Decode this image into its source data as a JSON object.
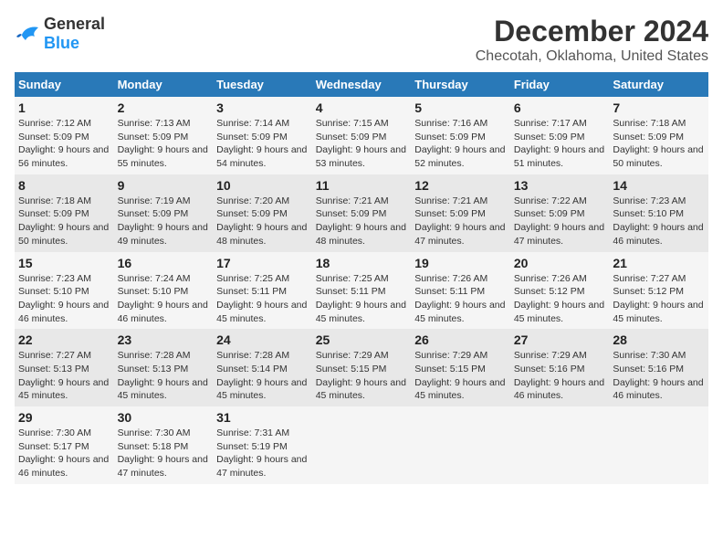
{
  "logo": {
    "general": "General",
    "blue": "Blue"
  },
  "title": "December 2024",
  "subtitle": "Checotah, Oklahoma, United States",
  "headers": [
    "Sunday",
    "Monday",
    "Tuesday",
    "Wednesday",
    "Thursday",
    "Friday",
    "Saturday"
  ],
  "weeks": [
    [
      {
        "day": "1",
        "sunrise": "Sunrise: 7:12 AM",
        "sunset": "Sunset: 5:09 PM",
        "daylight": "Daylight: 9 hours and 56 minutes."
      },
      {
        "day": "2",
        "sunrise": "Sunrise: 7:13 AM",
        "sunset": "Sunset: 5:09 PM",
        "daylight": "Daylight: 9 hours and 55 minutes."
      },
      {
        "day": "3",
        "sunrise": "Sunrise: 7:14 AM",
        "sunset": "Sunset: 5:09 PM",
        "daylight": "Daylight: 9 hours and 54 minutes."
      },
      {
        "day": "4",
        "sunrise": "Sunrise: 7:15 AM",
        "sunset": "Sunset: 5:09 PM",
        "daylight": "Daylight: 9 hours and 53 minutes."
      },
      {
        "day": "5",
        "sunrise": "Sunrise: 7:16 AM",
        "sunset": "Sunset: 5:09 PM",
        "daylight": "Daylight: 9 hours and 52 minutes."
      },
      {
        "day": "6",
        "sunrise": "Sunrise: 7:17 AM",
        "sunset": "Sunset: 5:09 PM",
        "daylight": "Daylight: 9 hours and 51 minutes."
      },
      {
        "day": "7",
        "sunrise": "Sunrise: 7:18 AM",
        "sunset": "Sunset: 5:09 PM",
        "daylight": "Daylight: 9 hours and 50 minutes."
      }
    ],
    [
      {
        "day": "8",
        "sunrise": "Sunrise: 7:18 AM",
        "sunset": "Sunset: 5:09 PM",
        "daylight": "Daylight: 9 hours and 50 minutes."
      },
      {
        "day": "9",
        "sunrise": "Sunrise: 7:19 AM",
        "sunset": "Sunset: 5:09 PM",
        "daylight": "Daylight: 9 hours and 49 minutes."
      },
      {
        "day": "10",
        "sunrise": "Sunrise: 7:20 AM",
        "sunset": "Sunset: 5:09 PM",
        "daylight": "Daylight: 9 hours and 48 minutes."
      },
      {
        "day": "11",
        "sunrise": "Sunrise: 7:21 AM",
        "sunset": "Sunset: 5:09 PM",
        "daylight": "Daylight: 9 hours and 48 minutes."
      },
      {
        "day": "12",
        "sunrise": "Sunrise: 7:21 AM",
        "sunset": "Sunset: 5:09 PM",
        "daylight": "Daylight: 9 hours and 47 minutes."
      },
      {
        "day": "13",
        "sunrise": "Sunrise: 7:22 AM",
        "sunset": "Sunset: 5:09 PM",
        "daylight": "Daylight: 9 hours and 47 minutes."
      },
      {
        "day": "14",
        "sunrise": "Sunrise: 7:23 AM",
        "sunset": "Sunset: 5:10 PM",
        "daylight": "Daylight: 9 hours and 46 minutes."
      }
    ],
    [
      {
        "day": "15",
        "sunrise": "Sunrise: 7:23 AM",
        "sunset": "Sunset: 5:10 PM",
        "daylight": "Daylight: 9 hours and 46 minutes."
      },
      {
        "day": "16",
        "sunrise": "Sunrise: 7:24 AM",
        "sunset": "Sunset: 5:10 PM",
        "daylight": "Daylight: 9 hours and 46 minutes."
      },
      {
        "day": "17",
        "sunrise": "Sunrise: 7:25 AM",
        "sunset": "Sunset: 5:11 PM",
        "daylight": "Daylight: 9 hours and 45 minutes."
      },
      {
        "day": "18",
        "sunrise": "Sunrise: 7:25 AM",
        "sunset": "Sunset: 5:11 PM",
        "daylight": "Daylight: 9 hours and 45 minutes."
      },
      {
        "day": "19",
        "sunrise": "Sunrise: 7:26 AM",
        "sunset": "Sunset: 5:11 PM",
        "daylight": "Daylight: 9 hours and 45 minutes."
      },
      {
        "day": "20",
        "sunrise": "Sunrise: 7:26 AM",
        "sunset": "Sunset: 5:12 PM",
        "daylight": "Daylight: 9 hours and 45 minutes."
      },
      {
        "day": "21",
        "sunrise": "Sunrise: 7:27 AM",
        "sunset": "Sunset: 5:12 PM",
        "daylight": "Daylight: 9 hours and 45 minutes."
      }
    ],
    [
      {
        "day": "22",
        "sunrise": "Sunrise: 7:27 AM",
        "sunset": "Sunset: 5:13 PM",
        "daylight": "Daylight: 9 hours and 45 minutes."
      },
      {
        "day": "23",
        "sunrise": "Sunrise: 7:28 AM",
        "sunset": "Sunset: 5:13 PM",
        "daylight": "Daylight: 9 hours and 45 minutes."
      },
      {
        "day": "24",
        "sunrise": "Sunrise: 7:28 AM",
        "sunset": "Sunset: 5:14 PM",
        "daylight": "Daylight: 9 hours and 45 minutes."
      },
      {
        "day": "25",
        "sunrise": "Sunrise: 7:29 AM",
        "sunset": "Sunset: 5:15 PM",
        "daylight": "Daylight: 9 hours and 45 minutes."
      },
      {
        "day": "26",
        "sunrise": "Sunrise: 7:29 AM",
        "sunset": "Sunset: 5:15 PM",
        "daylight": "Daylight: 9 hours and 45 minutes."
      },
      {
        "day": "27",
        "sunrise": "Sunrise: 7:29 AM",
        "sunset": "Sunset: 5:16 PM",
        "daylight": "Daylight: 9 hours and 46 minutes."
      },
      {
        "day": "28",
        "sunrise": "Sunrise: 7:30 AM",
        "sunset": "Sunset: 5:16 PM",
        "daylight": "Daylight: 9 hours and 46 minutes."
      }
    ],
    [
      {
        "day": "29",
        "sunrise": "Sunrise: 7:30 AM",
        "sunset": "Sunset: 5:17 PM",
        "daylight": "Daylight: 9 hours and 46 minutes."
      },
      {
        "day": "30",
        "sunrise": "Sunrise: 7:30 AM",
        "sunset": "Sunset: 5:18 PM",
        "daylight": "Daylight: 9 hours and 47 minutes."
      },
      {
        "day": "31",
        "sunrise": "Sunrise: 7:31 AM",
        "sunset": "Sunset: 5:19 PM",
        "daylight": "Daylight: 9 hours and 47 minutes."
      },
      null,
      null,
      null,
      null
    ]
  ]
}
